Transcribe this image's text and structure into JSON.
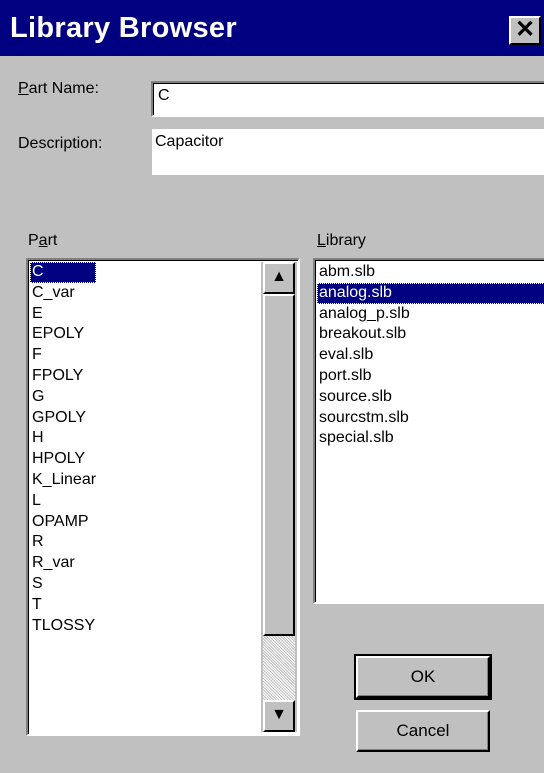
{
  "window": {
    "title": "Library Browser",
    "close_glyph": "✕"
  },
  "part_name": {
    "label_prefix": "P",
    "label_rest": "art Name:",
    "value": "C"
  },
  "description": {
    "label": "Description:",
    "value": "Capacitor"
  },
  "part_list": {
    "label_prefix": "P",
    "label_underlined": "a",
    "label_rest": "rt",
    "items": [
      "C",
      "C_var",
      "E",
      "EPOLY",
      "F",
      "FPOLY",
      "G",
      "GPOLY",
      "H",
      "HPOLY",
      "K_Linear",
      "L",
      "OPAMP",
      "R",
      "R_var",
      "S",
      "T",
      "TLOSSY"
    ],
    "selected": "C"
  },
  "library_list": {
    "label_underlined": "L",
    "label_rest": "ibrary",
    "items": [
      "abm.slb",
      "analog.slb",
      "analog_p.slb",
      "breakout.slb",
      "eval.slb",
      "port.slb",
      "source.slb",
      "sourcstm.slb",
      "special.slb"
    ],
    "selected": "analog.slb"
  },
  "buttons": {
    "ok": "OK",
    "cancel": "Cancel"
  },
  "icons": {
    "scroll_up": "▲",
    "scroll_down": "▼"
  }
}
